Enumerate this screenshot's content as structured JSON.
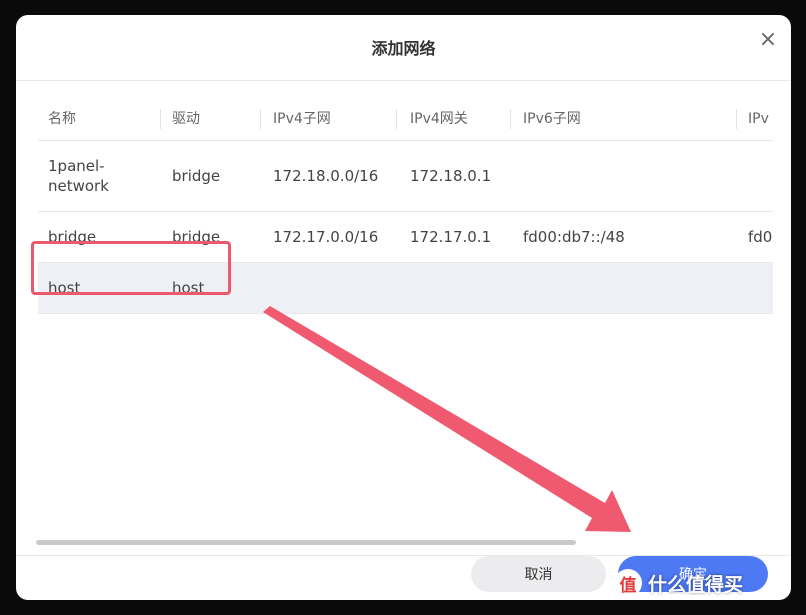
{
  "dialog": {
    "title": "添加网络",
    "close_icon": "×"
  },
  "table": {
    "headers": [
      "名称",
      "驱动",
      "IPv4子网",
      "IPv4网关",
      "IPv6子网",
      "IPv"
    ],
    "rows": [
      {
        "name": "1panel-\nnetwork",
        "driver": "bridge",
        "ipv4_subnet": "172.18.0.0/16",
        "ipv4_gateway": "172.18.0.1",
        "ipv6_subnet": "",
        "extra": ""
      },
      {
        "name": "bridge",
        "driver": "bridge",
        "ipv4_subnet": "172.17.0.0/16",
        "ipv4_gateway": "172.17.0.1",
        "ipv6_subnet": "fd00:db7::/48",
        "extra": "fd0"
      },
      {
        "name": "host",
        "driver": "host",
        "ipv4_subnet": "",
        "ipv4_gateway": "",
        "ipv6_subnet": "",
        "extra": ""
      }
    ],
    "selected_row": "host"
  },
  "footer": {
    "cancel_label": "取消",
    "confirm_label": "确定"
  },
  "annotation": {
    "highlight_color": "#ea5a6c",
    "arrow_color": "#f05a70"
  },
  "watermark": {
    "logo": "值",
    "text": "什么值得买"
  },
  "colors": {
    "primary": "#4d79f5",
    "selected_row": "#eef0f6"
  }
}
